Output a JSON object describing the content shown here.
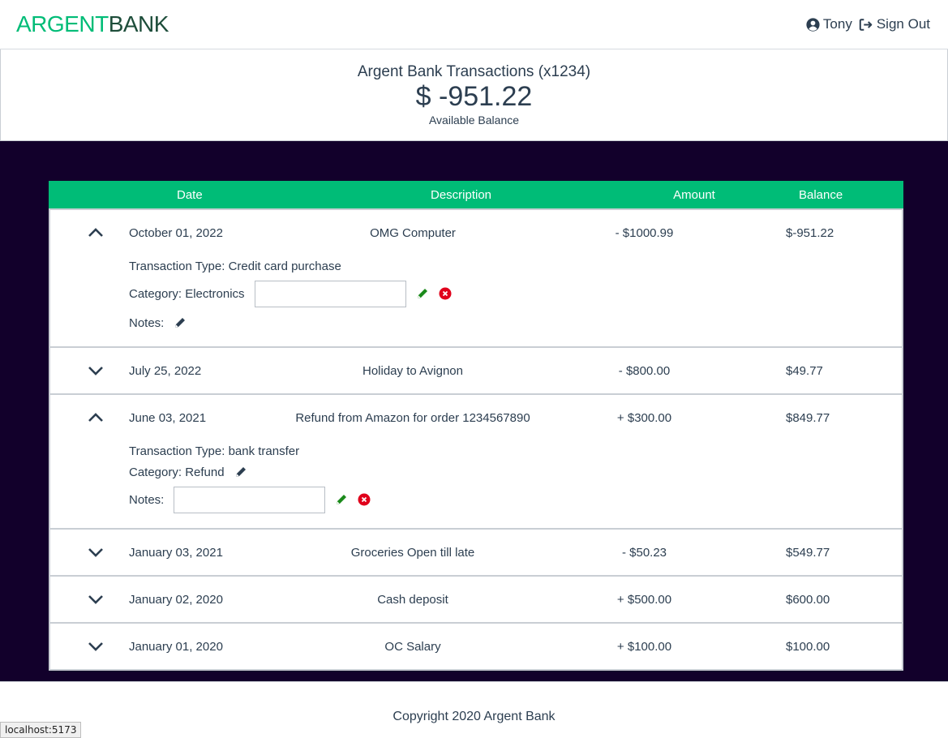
{
  "nav": {
    "logo_part1": "ARGENT",
    "logo_part2": "BANK",
    "user_name": "Tony",
    "sign_out_label": "Sign Out"
  },
  "header": {
    "title": "Argent Bank Transactions (x1234)",
    "balance": "$ -951.22",
    "subtitle": "Available Balance"
  },
  "table": {
    "columns": [
      "Date",
      "Description",
      "Amount",
      "Balance"
    ],
    "rows": [
      {
        "date": "October 01, 2022",
        "description": "OMG Computer",
        "amount": "- $1000.99",
        "balance": "$-951.22",
        "expanded": true,
        "transaction_type": "Transaction Type: Credit card purchase",
        "category": "Category: Electronics",
        "notes": "Notes:"
      },
      {
        "date": "July 25, 2022",
        "description": "Holiday to Avignon",
        "amount": "- $800.00",
        "balance": "$49.77",
        "expanded": false
      },
      {
        "date": "June 03, 2021",
        "description": "Refund from Amazon for order 1234567890",
        "amount": "+ $300.00",
        "balance": "$849.77",
        "expanded": true,
        "transaction_type": "Transaction Type: bank transfer",
        "category": "Category: Refund",
        "notes": "Notes:"
      },
      {
        "date": "January 03, 2021",
        "description": "Groceries Open till late",
        "amount": "- $50.23",
        "balance": "$549.77",
        "expanded": false
      },
      {
        "date": "January 02, 2020",
        "description": "Cash deposit",
        "amount": "+ $500.00",
        "balance": "$600.00",
        "expanded": false
      },
      {
        "date": "January 01, 2020",
        "description": "OC Salary",
        "amount": "+ $100.00",
        "balance": "$100.00",
        "expanded": false
      }
    ]
  },
  "footer": {
    "copyright": "Copyright 2020 Argent Bank"
  },
  "status_bar": {
    "url": "localhost:5173"
  },
  "colors": {
    "accent": "#00bc77",
    "logo_dark": "#1d4d3a",
    "main_bg": "#12002b",
    "edit_green": "#1b8a1b",
    "cancel_red": "#e0001b"
  }
}
